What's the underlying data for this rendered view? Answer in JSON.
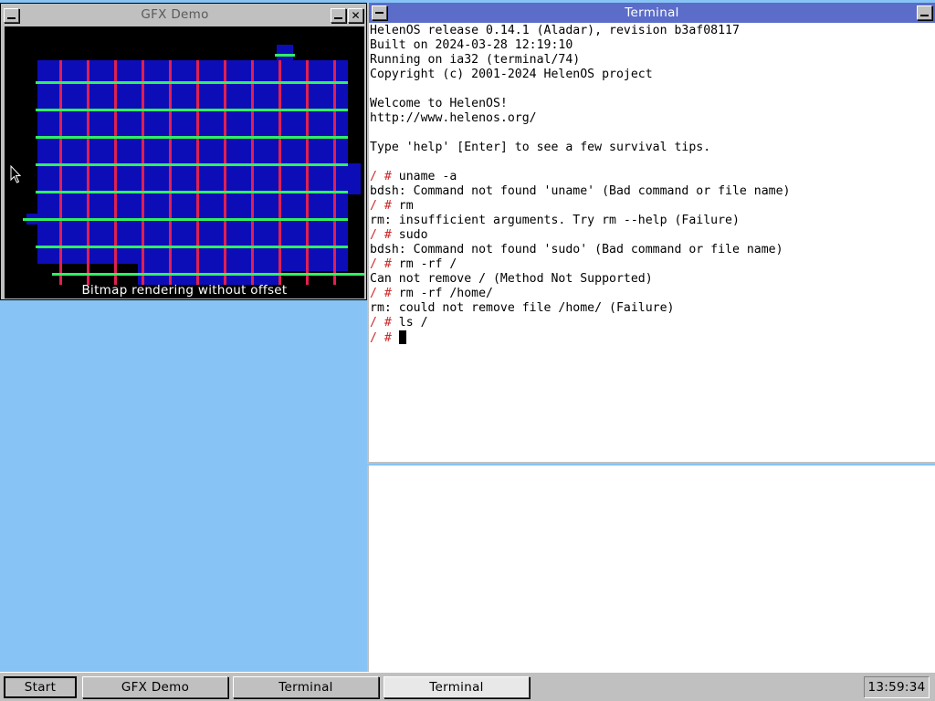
{
  "gfx_window": {
    "title": "GFX Demo",
    "minimize_icon": "minimize-icon",
    "close_icon": "close-icon",
    "close_glyph": "✕",
    "caption": "Bitmap rendering without offset",
    "colors": {
      "background": "#000000",
      "bitmap": "#0d0db8",
      "vertical_lines": "#e02050",
      "horizontal_lines": "#30f060"
    }
  },
  "terminal_window": {
    "title": "Terminal",
    "minimize_icon": "minimize-icon",
    "prompt": "/ #",
    "lines": [
      {
        "type": "out",
        "text": "HelenOS release 0.14.1 (Aladar), revision b3af08117"
      },
      {
        "type": "out",
        "text": "Built on 2024-03-28 12:19:10"
      },
      {
        "type": "out",
        "text": "Running on ia32 (terminal/74)"
      },
      {
        "type": "out",
        "text": "Copyright (c) 2001-2024 HelenOS project"
      },
      {
        "type": "out",
        "text": ""
      },
      {
        "type": "out",
        "text": "Welcome to HelenOS!"
      },
      {
        "type": "out",
        "text": "http://www.helenos.org/"
      },
      {
        "type": "out",
        "text": ""
      },
      {
        "type": "out",
        "text": "Type 'help' [Enter] to see a few survival tips."
      },
      {
        "type": "out",
        "text": ""
      },
      {
        "type": "cmd",
        "text": "uname -a"
      },
      {
        "type": "out",
        "text": "bdsh: Command not found 'uname' (Bad command or file name)"
      },
      {
        "type": "cmd",
        "text": "rm"
      },
      {
        "type": "out",
        "text": "rm: insufficient arguments. Try rm --help (Failure)"
      },
      {
        "type": "cmd",
        "text": "sudo"
      },
      {
        "type": "out",
        "text": "bdsh: Command not found 'sudo' (Bad command or file name)"
      },
      {
        "type": "cmd",
        "text": "rm -rf /"
      },
      {
        "type": "out",
        "text": "Can not remove / (Method Not Supported)"
      },
      {
        "type": "cmd",
        "text": "rm -rf /home/"
      },
      {
        "type": "out",
        "text": "rm: could not remove file /home/ (Failure)"
      },
      {
        "type": "cmd",
        "text": "ls /"
      },
      {
        "type": "input",
        "text": ""
      }
    ],
    "colors": {
      "titlebar": "#5b6cc9",
      "prompt": "#cc2a2a"
    }
  },
  "taskbar": {
    "start_label": "Start",
    "items": [
      {
        "label": "GFX Demo",
        "active": false
      },
      {
        "label": "Terminal",
        "active": false
      },
      {
        "label": "Terminal",
        "active": true
      }
    ],
    "clock": "13:59:34"
  },
  "desktop": {
    "background": "#87c4f5",
    "pointer_icon": "mouse-pointer-icon"
  }
}
